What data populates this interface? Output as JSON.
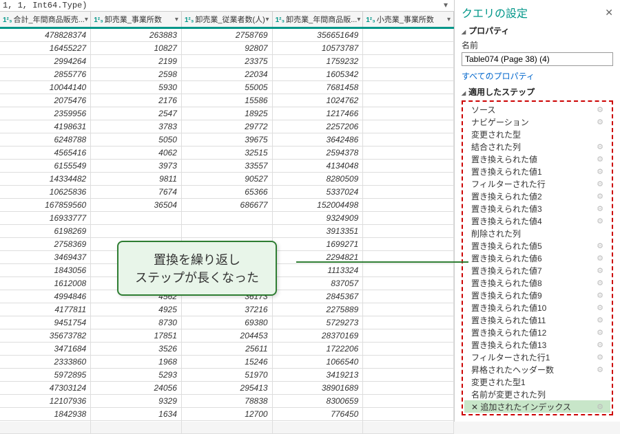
{
  "formula": "1, 1, Int64.Type)",
  "columns": [
    "合計_年間商品販売...",
    "卸売業_事業所数",
    "卸売業_従業者数(人)",
    "卸売業_年間商品販...",
    "小売業_事業所数"
  ],
  "type_prefix": "1²₃",
  "rows": [
    [
      "478828374",
      "263883",
      "2758769",
      "356651649",
      ""
    ],
    [
      "16455227",
      "10827",
      "92807",
      "10573787",
      ""
    ],
    [
      "2994264",
      "2199",
      "23375",
      "1759232",
      ""
    ],
    [
      "2855776",
      "2598",
      "22034",
      "1605342",
      ""
    ],
    [
      "10044140",
      "5930",
      "55005",
      "7681458",
      ""
    ],
    [
      "2075476",
      "2176",
      "15586",
      "1024762",
      ""
    ],
    [
      "2359956",
      "2547",
      "18925",
      "1217466",
      ""
    ],
    [
      "4198631",
      "3783",
      "29772",
      "2257206",
      ""
    ],
    [
      "6248788",
      "5050",
      "39675",
      "3642486",
      ""
    ],
    [
      "4565416",
      "4062",
      "32515",
      "2594378",
      ""
    ],
    [
      "6155549",
      "3973",
      "33557",
      "4134048",
      ""
    ],
    [
      "14334482",
      "9811",
      "90527",
      "8280509",
      ""
    ],
    [
      "10625836",
      "7674",
      "65366",
      "5337024",
      ""
    ],
    [
      "167859560",
      "36504",
      "686677",
      "152004498",
      ""
    ],
    [
      "16933777",
      "",
      "",
      "9324909",
      ""
    ],
    [
      "6198269",
      "",
      "",
      "3913351",
      ""
    ],
    [
      "2758369",
      "",
      "",
      "1699271",
      ""
    ],
    [
      "3469437",
      "",
      "",
      "2294821",
      ""
    ],
    [
      "1843056",
      "",
      "",
      "1113324",
      ""
    ],
    [
      "1612008",
      "",
      "",
      "837057",
      ""
    ],
    [
      "4994846",
      "4562",
      "36173",
      "2845367",
      ""
    ],
    [
      "4177811",
      "4925",
      "37216",
      "2275889",
      ""
    ],
    [
      "9451754",
      "8730",
      "69380",
      "5729273",
      ""
    ],
    [
      "35673782",
      "17851",
      "204453",
      "28370169",
      ""
    ],
    [
      "3471684",
      "3526",
      "25611",
      "1722206",
      ""
    ],
    [
      "2333860",
      "1968",
      "15246",
      "1066540",
      ""
    ],
    [
      "5972895",
      "5293",
      "51970",
      "3419213",
      ""
    ],
    [
      "47303124",
      "24056",
      "295413",
      "38901689",
      ""
    ],
    [
      "12107936",
      "9329",
      "78838",
      "8300659",
      ""
    ],
    [
      "1842938",
      "1634",
      "12700",
      "776450",
      ""
    ],
    [
      "",
      "",
      "",
      "",
      ""
    ]
  ],
  "settings": {
    "title": "クエリの設定",
    "properties_hdr": "プロパティ",
    "name_label": "名前",
    "name_value": "Table074 (Page 38) (4)",
    "all_props_link": "すべてのプロパティ",
    "steps_hdr": "適用したステップ",
    "steps": [
      {
        "label": "ソース",
        "gear": true
      },
      {
        "label": "ナビゲーション",
        "gear": true
      },
      {
        "label": "変更された型",
        "gear": false
      },
      {
        "label": "結合された列",
        "gear": true
      },
      {
        "label": "置き換えられた値",
        "gear": true
      },
      {
        "label": "置き換えられた値1",
        "gear": true
      },
      {
        "label": "フィルターされた行",
        "gear": true
      },
      {
        "label": "置き換えられた値2",
        "gear": true
      },
      {
        "label": "置き換えられた値3",
        "gear": true
      },
      {
        "label": "置き換えられた値4",
        "gear": true
      },
      {
        "label": "削除された列",
        "gear": false
      },
      {
        "label": "置き換えられた値5",
        "gear": true
      },
      {
        "label": "置き換えられた値6",
        "gear": true
      },
      {
        "label": "置き換えられた値7",
        "gear": true
      },
      {
        "label": "置き換えられた値8",
        "gear": true
      },
      {
        "label": "置き換えられた値9",
        "gear": true
      },
      {
        "label": "置き換えられた値10",
        "gear": true
      },
      {
        "label": "置き換えられた値11",
        "gear": true
      },
      {
        "label": "置き換えられた値12",
        "gear": true
      },
      {
        "label": "置き換えられた値13",
        "gear": true
      },
      {
        "label": "フィルターされた行1",
        "gear": true
      },
      {
        "label": "昇格されたヘッダー数",
        "gear": true
      },
      {
        "label": "変更された型1",
        "gear": false
      },
      {
        "label": "名前が変更された列",
        "gear": false
      },
      {
        "label": "追加されたインデックス",
        "gear": true,
        "sel": true,
        "prefix": "✕ "
      }
    ]
  },
  "callout": {
    "line1": "置換を繰り返し",
    "line2": "ステップが長くなった"
  }
}
